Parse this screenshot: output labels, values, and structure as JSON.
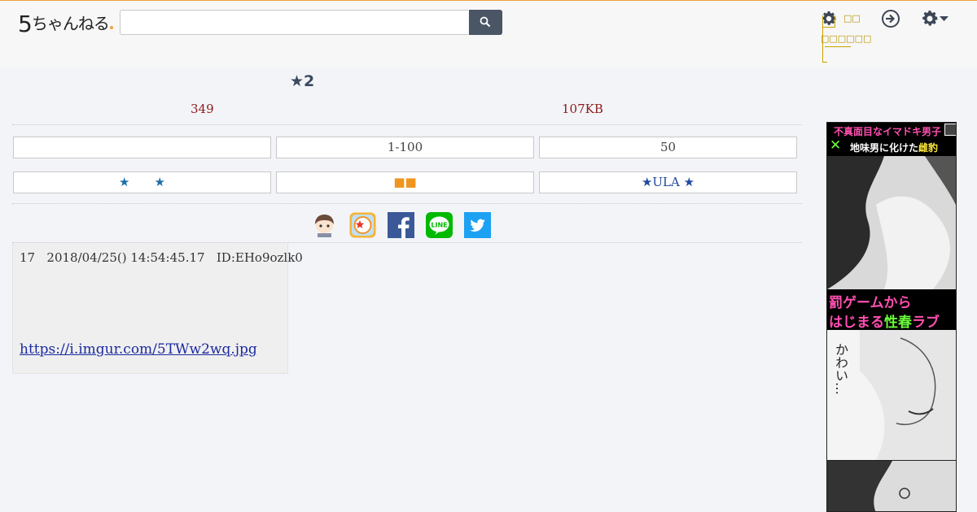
{
  "header": {
    "logo_digit": "5",
    "logo_text": "ちゃんねる",
    "search_placeholder": "",
    "search_icon": "search-icon",
    "user_icons": [
      "gear-icon",
      "login-icon",
      "settings-gear-dropdown-icon"
    ],
    "cjk_box1": "□□",
    "cjk_box2": "□□□□□□"
  },
  "thread": {
    "title": "★2",
    "count": "349",
    "size": "107KB"
  },
  "nav_row1": [
    "",
    "1-100",
    "50"
  ],
  "nav_row2": [
    "★　　★",
    "■■",
    "★ULA ★"
  ],
  "share": [
    "mascot-icon",
    "star-badge-icon",
    "facebook-icon",
    "line-icon",
    "twitter-icon"
  ],
  "share_line_text": "LINE",
  "post": {
    "number": "17",
    "date": "2018/04/25() 14:54:45.17",
    "id": "ID:EHo9ozlk0",
    "link": "https://i.imgur.com/5TWw2wq.jpg"
  },
  "ad": {
    "line1": "不真面目なイマドキ男子",
    "line2a": "地味男に化けた",
    "line2b": "雌豹",
    "line3": "罰ゲームから",
    "line4a": "はじまる",
    "line4b": "性春",
    "line4c": "ラブ",
    "bubble": "かわい…",
    "close_icon": "info-icon"
  },
  "colors": {
    "accent_orange": "#f0a23a",
    "search_button": "#4a5566",
    "meta_red": "#8b1a1a",
    "link_blue": "#1b2aa0"
  }
}
